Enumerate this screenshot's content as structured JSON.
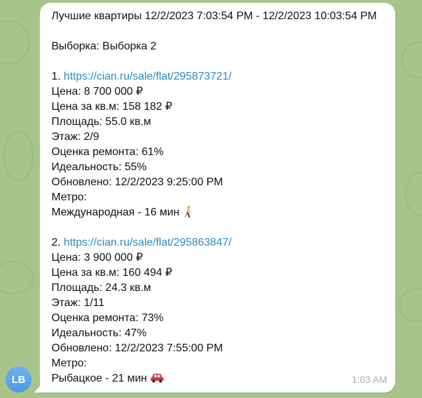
{
  "message": {
    "header": "Лучшие квартиры 12/2/2023 7:03:54 PM - 12/2/2023 10:03:54 PM",
    "selection": "Выборка: Выборка 2",
    "listings": [
      {
        "number": "1.",
        "url": "https://cian.ru/sale/flat/295873721/",
        "price": "Цена: 8 700 000 ₽",
        "price_per_m": "Цена за кв.м: 158 182 ₽",
        "area": "Площадь: 55.0 кв.м",
        "floor": "Этаж: 2/9",
        "repair": "Оценка ремонта: 61%",
        "ideal": "Идеальность: 55%",
        "updated": "Обновлено: 12/2/2023 9:25:00 PM",
        "metro_label": "Метро:",
        "metro": "Международная - 16 мин",
        "metro_icon": "walking-person-icon"
      },
      {
        "number": "2.",
        "url": "https://cian.ru/sale/flat/295863847/",
        "price": "Цена: 3 900 000 ₽",
        "price_per_m": "Цена за кв.м: 160 494 ₽",
        "area": "Площадь: 24.3 кв.м",
        "floor": "Этаж: 1/11",
        "repair": "Оценка ремонта: 73%",
        "ideal": "Идеальность: 47%",
        "updated": "Обновлено: 12/2/2023 7:55:00 PM",
        "metro_label": "Метро:",
        "metro": "Рыбацкое - 21 мин",
        "metro_icon": "car-icon"
      }
    ],
    "time": "1:03 AM"
  },
  "sender": {
    "initials": "LB"
  },
  "colors": {
    "link": "#2f86c1",
    "bubble": "#ffffff",
    "avatar": "#5ba4ea",
    "wallpaper": "#a9c48a"
  }
}
